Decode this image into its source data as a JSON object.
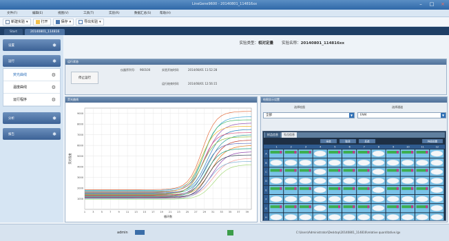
{
  "window": {
    "title": "LineGene9600 - 20140801_114816xx",
    "controls": [
      "–",
      "□",
      "×"
    ]
  },
  "menu": [
    "文件(F)",
    "编辑(E)",
    "视图(V)",
    "工具(T)",
    "实验(R)",
    "数据汇总(S)",
    "帮助(H)"
  ],
  "toolbar": {
    "new_label": "新建实验",
    "open_label": "打开",
    "save_label": "保存",
    "export_label": "导出实验"
  },
  "tabs": [
    {
      "label": "Start",
      "active": false
    },
    {
      "label": "20140801_114816",
      "active": true
    }
  ],
  "sidebar": {
    "groups": [
      {
        "label": "设置",
        "items": []
      },
      {
        "label": "运行",
        "items": [
          "荧光曲线",
          "温度曲线",
          "运行程序"
        ]
      },
      {
        "label": "分析",
        "items": []
      },
      {
        "label": "报告",
        "items": []
      }
    ],
    "active_item": "荧光曲线"
  },
  "experiment": {
    "type_label": "实验类型：",
    "type_value": "相对定量",
    "name_label": "实验名称：",
    "name_value": "20140801_114816xx"
  },
  "run_status": {
    "header": "运行状态",
    "button": "停止运行",
    "instrument_label": "仪器序列号:",
    "instrument_value": "960100",
    "start_label": "实验开始时间:",
    "start_value": "2014/08/01 11:52:28",
    "end_label": "运行结束时间:",
    "end_value": "2014/08/01 12:56:15"
  },
  "amp_panel": {
    "header": "荧光曲线",
    "ylabel": "荧光强度",
    "xlabel": "循环数"
  },
  "chart_data": {
    "type": "line",
    "x": [
      1,
      2,
      3,
      4,
      5,
      6,
      7,
      8,
      9,
      10,
      11,
      12,
      13,
      14,
      15,
      16,
      17,
      18,
      19,
      20,
      21,
      22,
      23,
      24,
      25,
      26,
      27,
      28,
      29,
      30,
      31,
      32,
      33,
      34,
      35,
      36,
      37,
      38,
      39,
      40
    ],
    "ylim": [
      0,
      9500
    ],
    "yticks": [
      1000,
      2000,
      3000,
      4000,
      5000,
      6000,
      7000,
      8000,
      9000
    ],
    "xlim": [
      1,
      40
    ],
    "grid": true,
    "series_params": [
      {
        "base": 1850,
        "plateau": 9200,
        "ct": 28.5,
        "slope": 1.6,
        "color": "#e36a3a"
      },
      {
        "base": 1780,
        "plateau": 8700,
        "ct": 29.0,
        "slope": 1.7,
        "color": "#3aa6d8"
      },
      {
        "base": 1700,
        "plateau": 8400,
        "ct": 28.8,
        "slope": 1.5,
        "color": "#44b86a"
      },
      {
        "base": 1650,
        "plateau": 8100,
        "ct": 29.3,
        "slope": 1.8,
        "color": "#9b59b6"
      },
      {
        "base": 1600,
        "plateau": 7800,
        "ct": 28.2,
        "slope": 1.6,
        "color": "#f0b429"
      },
      {
        "base": 1550,
        "plateau": 7500,
        "ct": 29.6,
        "slope": 1.7,
        "color": "#1f7fbf"
      },
      {
        "base": 1500,
        "plateau": 7200,
        "ct": 28.6,
        "slope": 1.5,
        "color": "#d64b7a"
      },
      {
        "base": 1450,
        "plateau": 7000,
        "ct": 29.9,
        "slope": 1.8,
        "color": "#27a19b"
      },
      {
        "base": 1400,
        "plateau": 6800,
        "ct": 28.4,
        "slope": 1.6,
        "color": "#8fbf3a"
      },
      {
        "base": 1350,
        "plateau": 6500,
        "ct": 30.2,
        "slope": 1.7,
        "color": "#c0392b"
      },
      {
        "base": 1300,
        "plateau": 6200,
        "ct": 29.1,
        "slope": 1.5,
        "color": "#5d6dbe"
      },
      {
        "base": 1250,
        "plateau": 6000,
        "ct": 30.5,
        "slope": 1.8,
        "color": "#e67e22"
      },
      {
        "base": 1200,
        "plateau": 5700,
        "ct": 29.4,
        "slope": 1.6,
        "color": "#16a085"
      },
      {
        "base": 1150,
        "plateau": 5400,
        "ct": 30.8,
        "slope": 1.7,
        "color": "#8e44ad"
      },
      {
        "base": 1100,
        "plateau": 5100,
        "ct": 29.7,
        "slope": 1.5,
        "color": "#2c3e50"
      },
      {
        "base": 1050,
        "plateau": 4800,
        "ct": 31.0,
        "slope": 1.8,
        "color": "#f39c9c"
      },
      {
        "base": 1000,
        "plateau": 4500,
        "ct": 30.0,
        "slope": 1.6,
        "color": "#7fb3d5"
      },
      {
        "base": 950,
        "plateau": 4200,
        "ct": 31.3,
        "slope": 1.7,
        "color": "#a3d977"
      }
    ]
  },
  "right_panel": {
    "header": "绘图显示设置",
    "sel1_label": "选择绘图",
    "sel1_value": "全部",
    "sel2_label": "选择通道",
    "sel2_value": "FAM",
    "plate_tabs": [
      "样品信息",
      "孔位信息"
    ],
    "plate_buttons": [
      "全选",
      "取消",
      "反选"
    ],
    "plate_right_btn": "样品设置",
    "col_headers": [
      "1",
      "2",
      "3",
      "4",
      "5",
      "6",
      "7",
      "8",
      "9",
      "10",
      "11",
      "12"
    ],
    "row_headers": [
      "A",
      "B",
      "C",
      "D",
      "E",
      "F",
      "G",
      "H"
    ]
  },
  "status_bar": {
    "user": "admin",
    "path": "C:\\Users\\Administrator\\Desktop\\20140801_114816\\relative quantitative.lgx"
  }
}
